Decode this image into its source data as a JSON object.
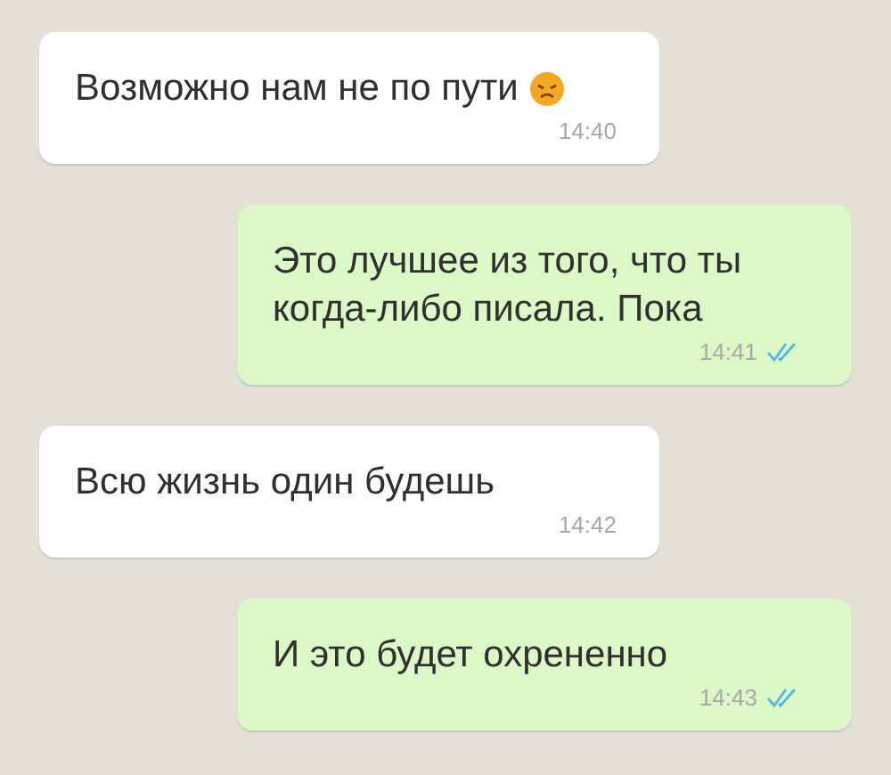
{
  "messages": [
    {
      "kind": "in",
      "text": "Возможно нам не по пути",
      "emoji": true,
      "time": "14:40"
    },
    {
      "kind": "out",
      "text": "Это лучшее из того, что ты когда-либо писала. Пока",
      "time": "14:41",
      "read": true
    },
    {
      "kind": "in",
      "text": "Всю жизнь один будешь",
      "time": "14:42"
    },
    {
      "kind": "out",
      "text": "И это будет охрененно",
      "time": "14:43",
      "read": true
    }
  ]
}
